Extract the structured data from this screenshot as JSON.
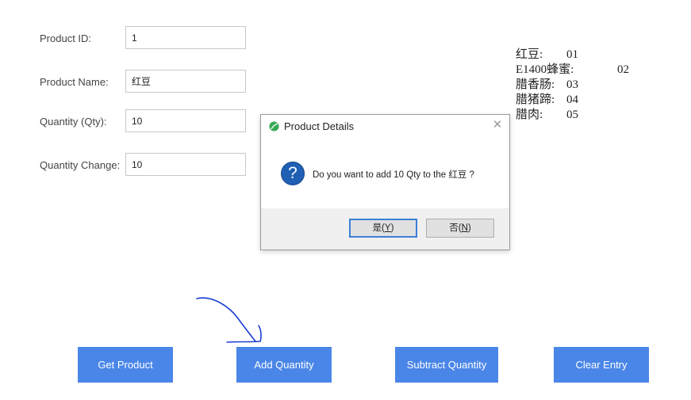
{
  "form": {
    "product_id": {
      "label": "Product ID:",
      "value": "1"
    },
    "product_name": {
      "label": "Product Name:",
      "value": "红豆"
    },
    "quantity": {
      "label": "Quantity (Qty):",
      "value": "10"
    },
    "quantity_change": {
      "label": "Quantity Change:",
      "value": "10"
    }
  },
  "legend": [
    {
      "name": "红豆:",
      "code": "01"
    },
    {
      "name": "E1400蜂蜜:",
      "code": "02"
    },
    {
      "name": "腊香肠:",
      "code": "03"
    },
    {
      "name": "腊猪蹄:",
      "code": "04"
    },
    {
      "name": "腊肉:",
      "code": "05"
    }
  ],
  "buttons": {
    "get_product": "Get Product",
    "add_quantity": "Add Quantity",
    "subtract_quantity": "Subtract Quantity",
    "clear_entry": "Clear Entry"
  },
  "dialog": {
    "title": "Product Details",
    "message": "Do you want to add 10 Qty to the 红豆 ?",
    "yes_label": "是(",
    "yes_key": "Y",
    "yes_end": ")",
    "no_label": "否(",
    "no_key": "N",
    "no_end": ")",
    "question_glyph": "?",
    "close_glyph": "✕"
  },
  "colors": {
    "button_bg": "#4a86e8",
    "scribble": "#1a3fd1",
    "question_icon": "#1f5fb4"
  }
}
